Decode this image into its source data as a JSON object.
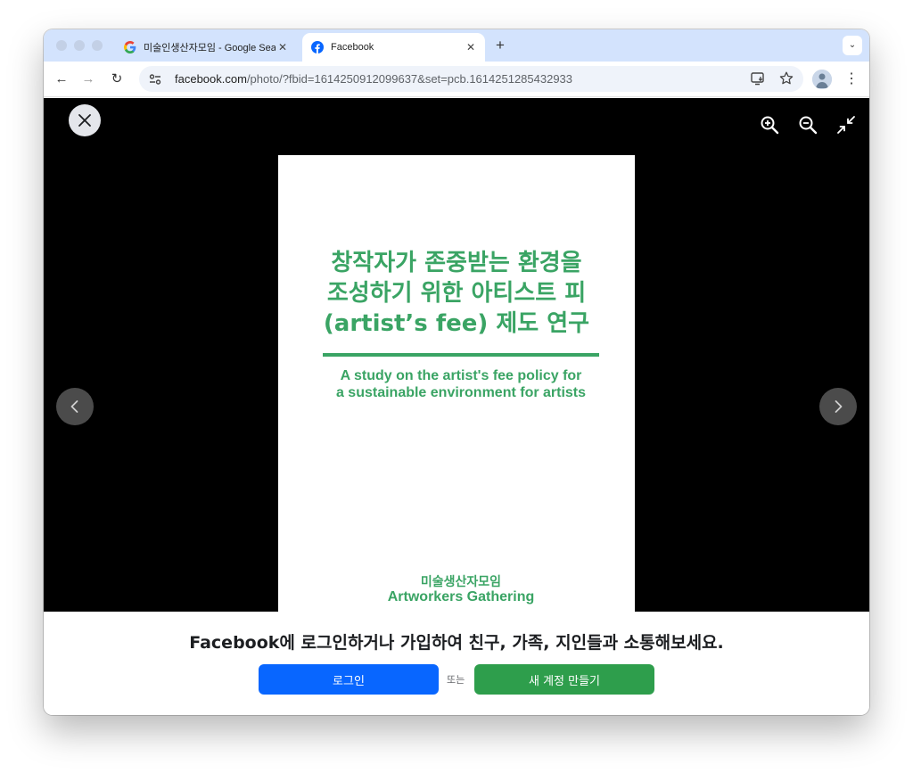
{
  "browser": {
    "tabs": [
      {
        "title": "미술인생산자모임 - Google Search",
        "favicon": "google-icon",
        "active": false
      },
      {
        "title": "Facebook",
        "favicon": "facebook-icon",
        "active": true
      }
    ],
    "close_tab_glyph": "✕",
    "new_tab_glyph": "+",
    "tab_menu_glyph": "⌄",
    "back_glyph": "←",
    "forward_glyph": "→",
    "reload_glyph": "↻",
    "menu_glyph": "⋮",
    "address": {
      "host": "facebook.com",
      "path": "/photo/?fbid=1614250912099637&set=pcb.1614251285432933"
    },
    "colors": {
      "tabbar": "#d3e3fd",
      "omnibox": "#eff3fa"
    }
  },
  "viewer": {
    "controls": [
      "close-icon",
      "zoom-in-icon",
      "zoom-out-icon",
      "exit-fullscreen-icon",
      "previous-icon",
      "next-icon"
    ],
    "photo": {
      "kr_title_lines": [
        "창작자가 존중받는 환경을",
        "조성하기 위한 아티스트 피",
        "(artist’s fee) 제도 연구"
      ],
      "en_title_lines": [
        "A study on the artist's fee policy for",
        "a sustainable environment for artists"
      ],
      "org_kr": "미술생산자모임",
      "org_en": "Artworkers Gathering",
      "accent_color": "#3aa464"
    }
  },
  "login_prompt": {
    "message": "Facebook에 로그인하거나 가입하여 친구, 가족, 지인들과 소통해보세요.",
    "login_label": "로그인",
    "or_label": "또는",
    "signup_label": "새 계정 만들기",
    "colors": {
      "login": "#0866ff",
      "signup": "#2e9e4c"
    }
  }
}
